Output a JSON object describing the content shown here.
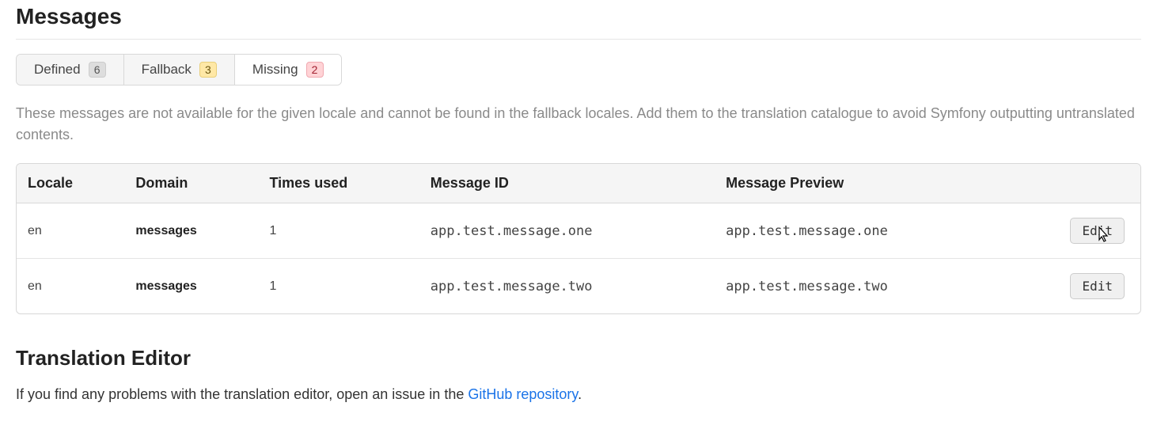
{
  "heading": "Messages",
  "tabs": [
    {
      "label": "Defined",
      "count": "6",
      "badge_class": "badge-gray",
      "active": false
    },
    {
      "label": "Fallback",
      "count": "3",
      "badge_class": "badge-yellow",
      "active": false
    },
    {
      "label": "Missing",
      "count": "2",
      "badge_class": "badge-red",
      "active": true
    }
  ],
  "description": "These messages are not available for the given locale and cannot be found in the fallback locales. Add them to the translation catalogue to avoid Symfony outputting untranslated contents.",
  "table": {
    "headers": {
      "locale": "Locale",
      "domain": "Domain",
      "times_used": "Times used",
      "message_id": "Message ID",
      "message_preview": "Message Preview",
      "action": ""
    },
    "rows": [
      {
        "locale": "en",
        "domain": "messages",
        "times_used": "1",
        "message_id": "app.test.message.one",
        "message_preview": "app.test.message.one",
        "action": "Edit",
        "hover": true
      },
      {
        "locale": "en",
        "domain": "messages",
        "times_used": "1",
        "message_id": "app.test.message.two",
        "message_preview": "app.test.message.two",
        "action": "Edit",
        "hover": false
      }
    ]
  },
  "editor": {
    "title": "Translation Editor",
    "text_before": "If you find any problems with the translation editor, open an issue in the ",
    "link_text": "GitHub repository",
    "text_after": "."
  }
}
